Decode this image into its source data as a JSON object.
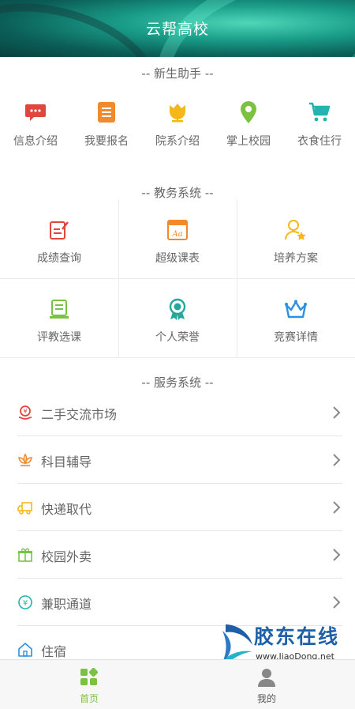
{
  "header": {
    "title": "云帮高校"
  },
  "sections": {
    "freshman": "-- 新生助手 --",
    "academic": "-- 教务系统 --",
    "service": "-- 服务系统 --"
  },
  "quick_items": [
    {
      "label": "信息介绍",
      "icon": "chat-bubble-icon",
      "color": "#e0463d"
    },
    {
      "label": "我要报名",
      "icon": "form-icon",
      "color": "#f08a2c"
    },
    {
      "label": "院系介绍",
      "icon": "tulip-icon",
      "color": "#f5b81b"
    },
    {
      "label": "掌上校园",
      "icon": "map-pin-icon",
      "color": "#7cc242"
    },
    {
      "label": "衣食住行",
      "icon": "cart-icon",
      "color": "#23b3b0"
    }
  ],
  "academic_items": [
    {
      "label": "成绩查询",
      "icon": "edit-note-icon",
      "color": "#e0463d"
    },
    {
      "label": "超级课表",
      "icon": "calendar-icon",
      "color": "#f08a2c"
    },
    {
      "label": "培养方案",
      "icon": "user-star-icon",
      "color": "#f5b81b"
    },
    {
      "label": "评教选课",
      "icon": "book-icon",
      "color": "#7cc242"
    },
    {
      "label": "个人荣誉",
      "icon": "medal-icon",
      "color": "#23a89a"
    },
    {
      "label": "竞赛详情",
      "icon": "crown-icon",
      "color": "#2f8fe0"
    }
  ],
  "service_items": [
    {
      "label": "二手交流市场",
      "icon": "coin-hand-icon",
      "color": "#e0463d"
    },
    {
      "label": "科目辅导",
      "icon": "lotus-icon",
      "color": "#f08a2c"
    },
    {
      "label": "快递取代",
      "icon": "truck-icon",
      "color": "#f5b81b"
    },
    {
      "label": "校园外卖",
      "icon": "gift-icon",
      "color": "#7cc242"
    },
    {
      "label": "兼职通道",
      "icon": "yen-icon",
      "color": "#23b3b0"
    },
    {
      "label": "住宿",
      "icon": "home-icon",
      "color": "#2f8fe0"
    }
  ],
  "tabbar": {
    "home_label": "首页",
    "mine_label": "我的",
    "active_color": "#7cc242"
  },
  "watermark": {
    "brand": "胶东在线",
    "url": "www.JiaoDong.net"
  }
}
